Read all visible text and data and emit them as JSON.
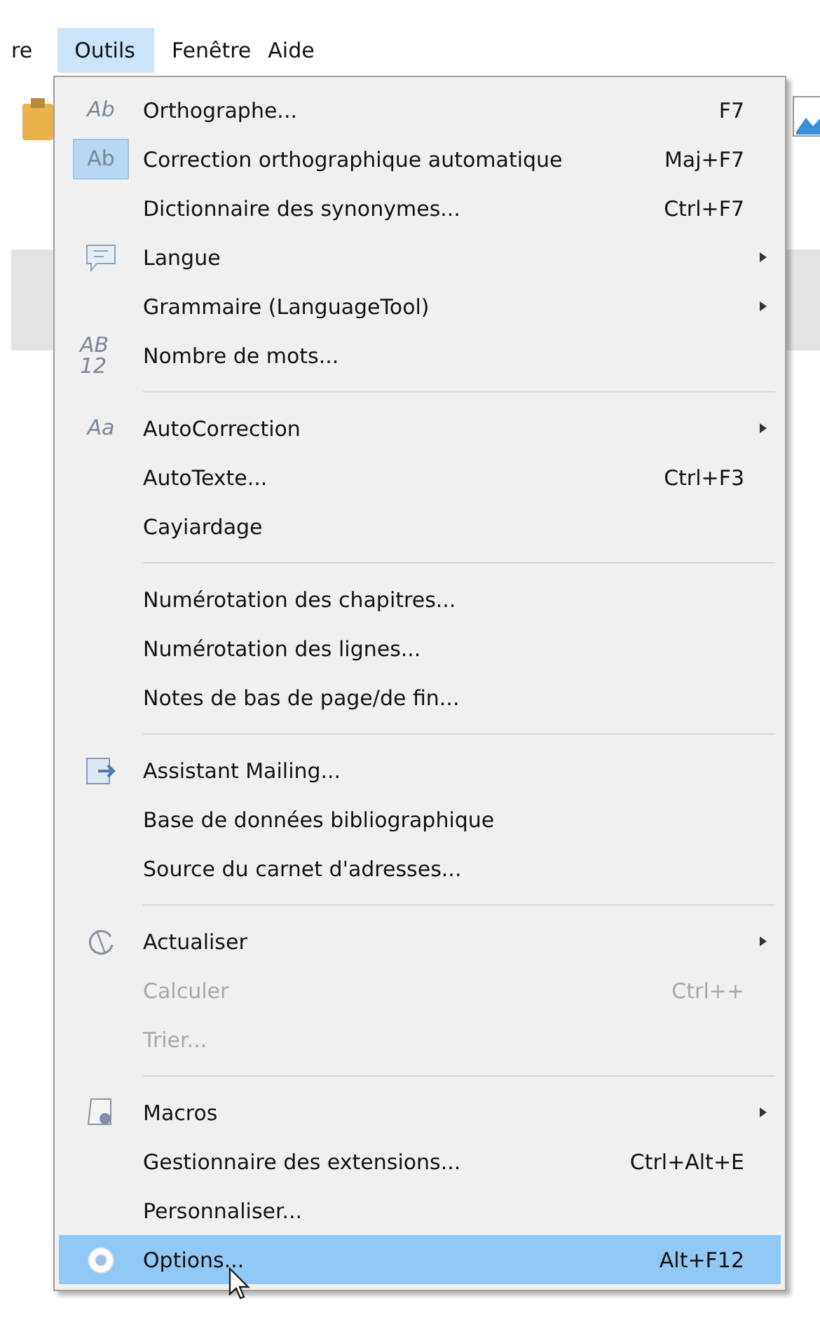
{
  "menubar": [
    {
      "label": "re",
      "selected": false
    },
    {
      "label": "Outils",
      "selected": true
    },
    {
      "label": "Fenêtre",
      "selected": false
    },
    {
      "label": "Aide",
      "selected": false
    }
  ],
  "menu": {
    "groups": [
      [
        {
          "label": "Orthographe...",
          "shortcut": "F7",
          "icon_label": "Ab",
          "submenu": false,
          "disabled": false,
          "checked": false,
          "selected": false
        },
        {
          "label": "Correction orthographique automatique",
          "shortcut": "Maj+F7",
          "icon_label": "Ab",
          "submenu": false,
          "disabled": false,
          "checked": true,
          "selected": false
        },
        {
          "label": "Dictionnaire des synonymes...",
          "shortcut": "Ctrl+F7",
          "submenu": false,
          "disabled": false,
          "checked": false,
          "selected": false
        },
        {
          "label": "Langue",
          "submenu": true,
          "disabled": false,
          "checked": false,
          "selected": false
        },
        {
          "label": "Grammaire (LanguageTool)",
          "submenu": true,
          "disabled": false,
          "checked": false,
          "selected": false
        },
        {
          "label": "Nombre de mots...",
          "icon_label": "AB 12",
          "submenu": false,
          "disabled": false,
          "checked": false,
          "selected": false
        }
      ],
      [
        {
          "label": "AutoCorrection",
          "icon_label": "Aa",
          "submenu": true,
          "disabled": false,
          "checked": false,
          "selected": false
        },
        {
          "label": "AutoTexte...",
          "shortcut": "Ctrl+F3",
          "submenu": false,
          "disabled": false,
          "checked": false,
          "selected": false
        },
        {
          "label": "Cayiardage",
          "submenu": false,
          "disabled": false,
          "checked": false,
          "selected": false
        }
      ],
      [
        {
          "label": "Numérotation des chapitres...",
          "submenu": false,
          "disabled": false,
          "checked": false,
          "selected": false
        },
        {
          "label": "Numérotation des lignes...",
          "submenu": false,
          "disabled": false,
          "checked": false,
          "selected": false
        },
        {
          "label": "Notes de bas de page/de fin...",
          "submenu": false,
          "disabled": false,
          "checked": false,
          "selected": false
        }
      ],
      [
        {
          "label": "Assistant Mailing...",
          "submenu": false,
          "disabled": false,
          "checked": false,
          "selected": false
        },
        {
          "label": "Base de données bibliographique",
          "submenu": false,
          "disabled": false,
          "checked": false,
          "selected": false
        },
        {
          "label": "Source du carnet d'adresses...",
          "submenu": false,
          "disabled": false,
          "checked": false,
          "selected": false
        }
      ],
      [
        {
          "label": "Actualiser",
          "submenu": true,
          "disabled": false,
          "checked": false,
          "selected": false
        },
        {
          "label": "Calculer",
          "shortcut": "Ctrl++",
          "submenu": false,
          "disabled": true,
          "checked": false,
          "selected": false
        },
        {
          "label": "Trier...",
          "submenu": false,
          "disabled": true,
          "checked": false,
          "selected": false
        }
      ],
      [
        {
          "label": "Macros",
          "submenu": true,
          "disabled": false,
          "checked": false,
          "selected": false
        },
        {
          "label": "Gestionnaire des extensions...",
          "shortcut": "Ctrl+Alt+E",
          "submenu": false,
          "disabled": false,
          "checked": false,
          "selected": false
        },
        {
          "label": "Personnaliser...",
          "submenu": false,
          "disabled": false,
          "checked": false,
          "selected": false
        },
        {
          "label": "Options...",
          "shortcut": "Alt+F12",
          "submenu": false,
          "disabled": false,
          "checked": false,
          "selected": true
        }
      ]
    ]
  }
}
